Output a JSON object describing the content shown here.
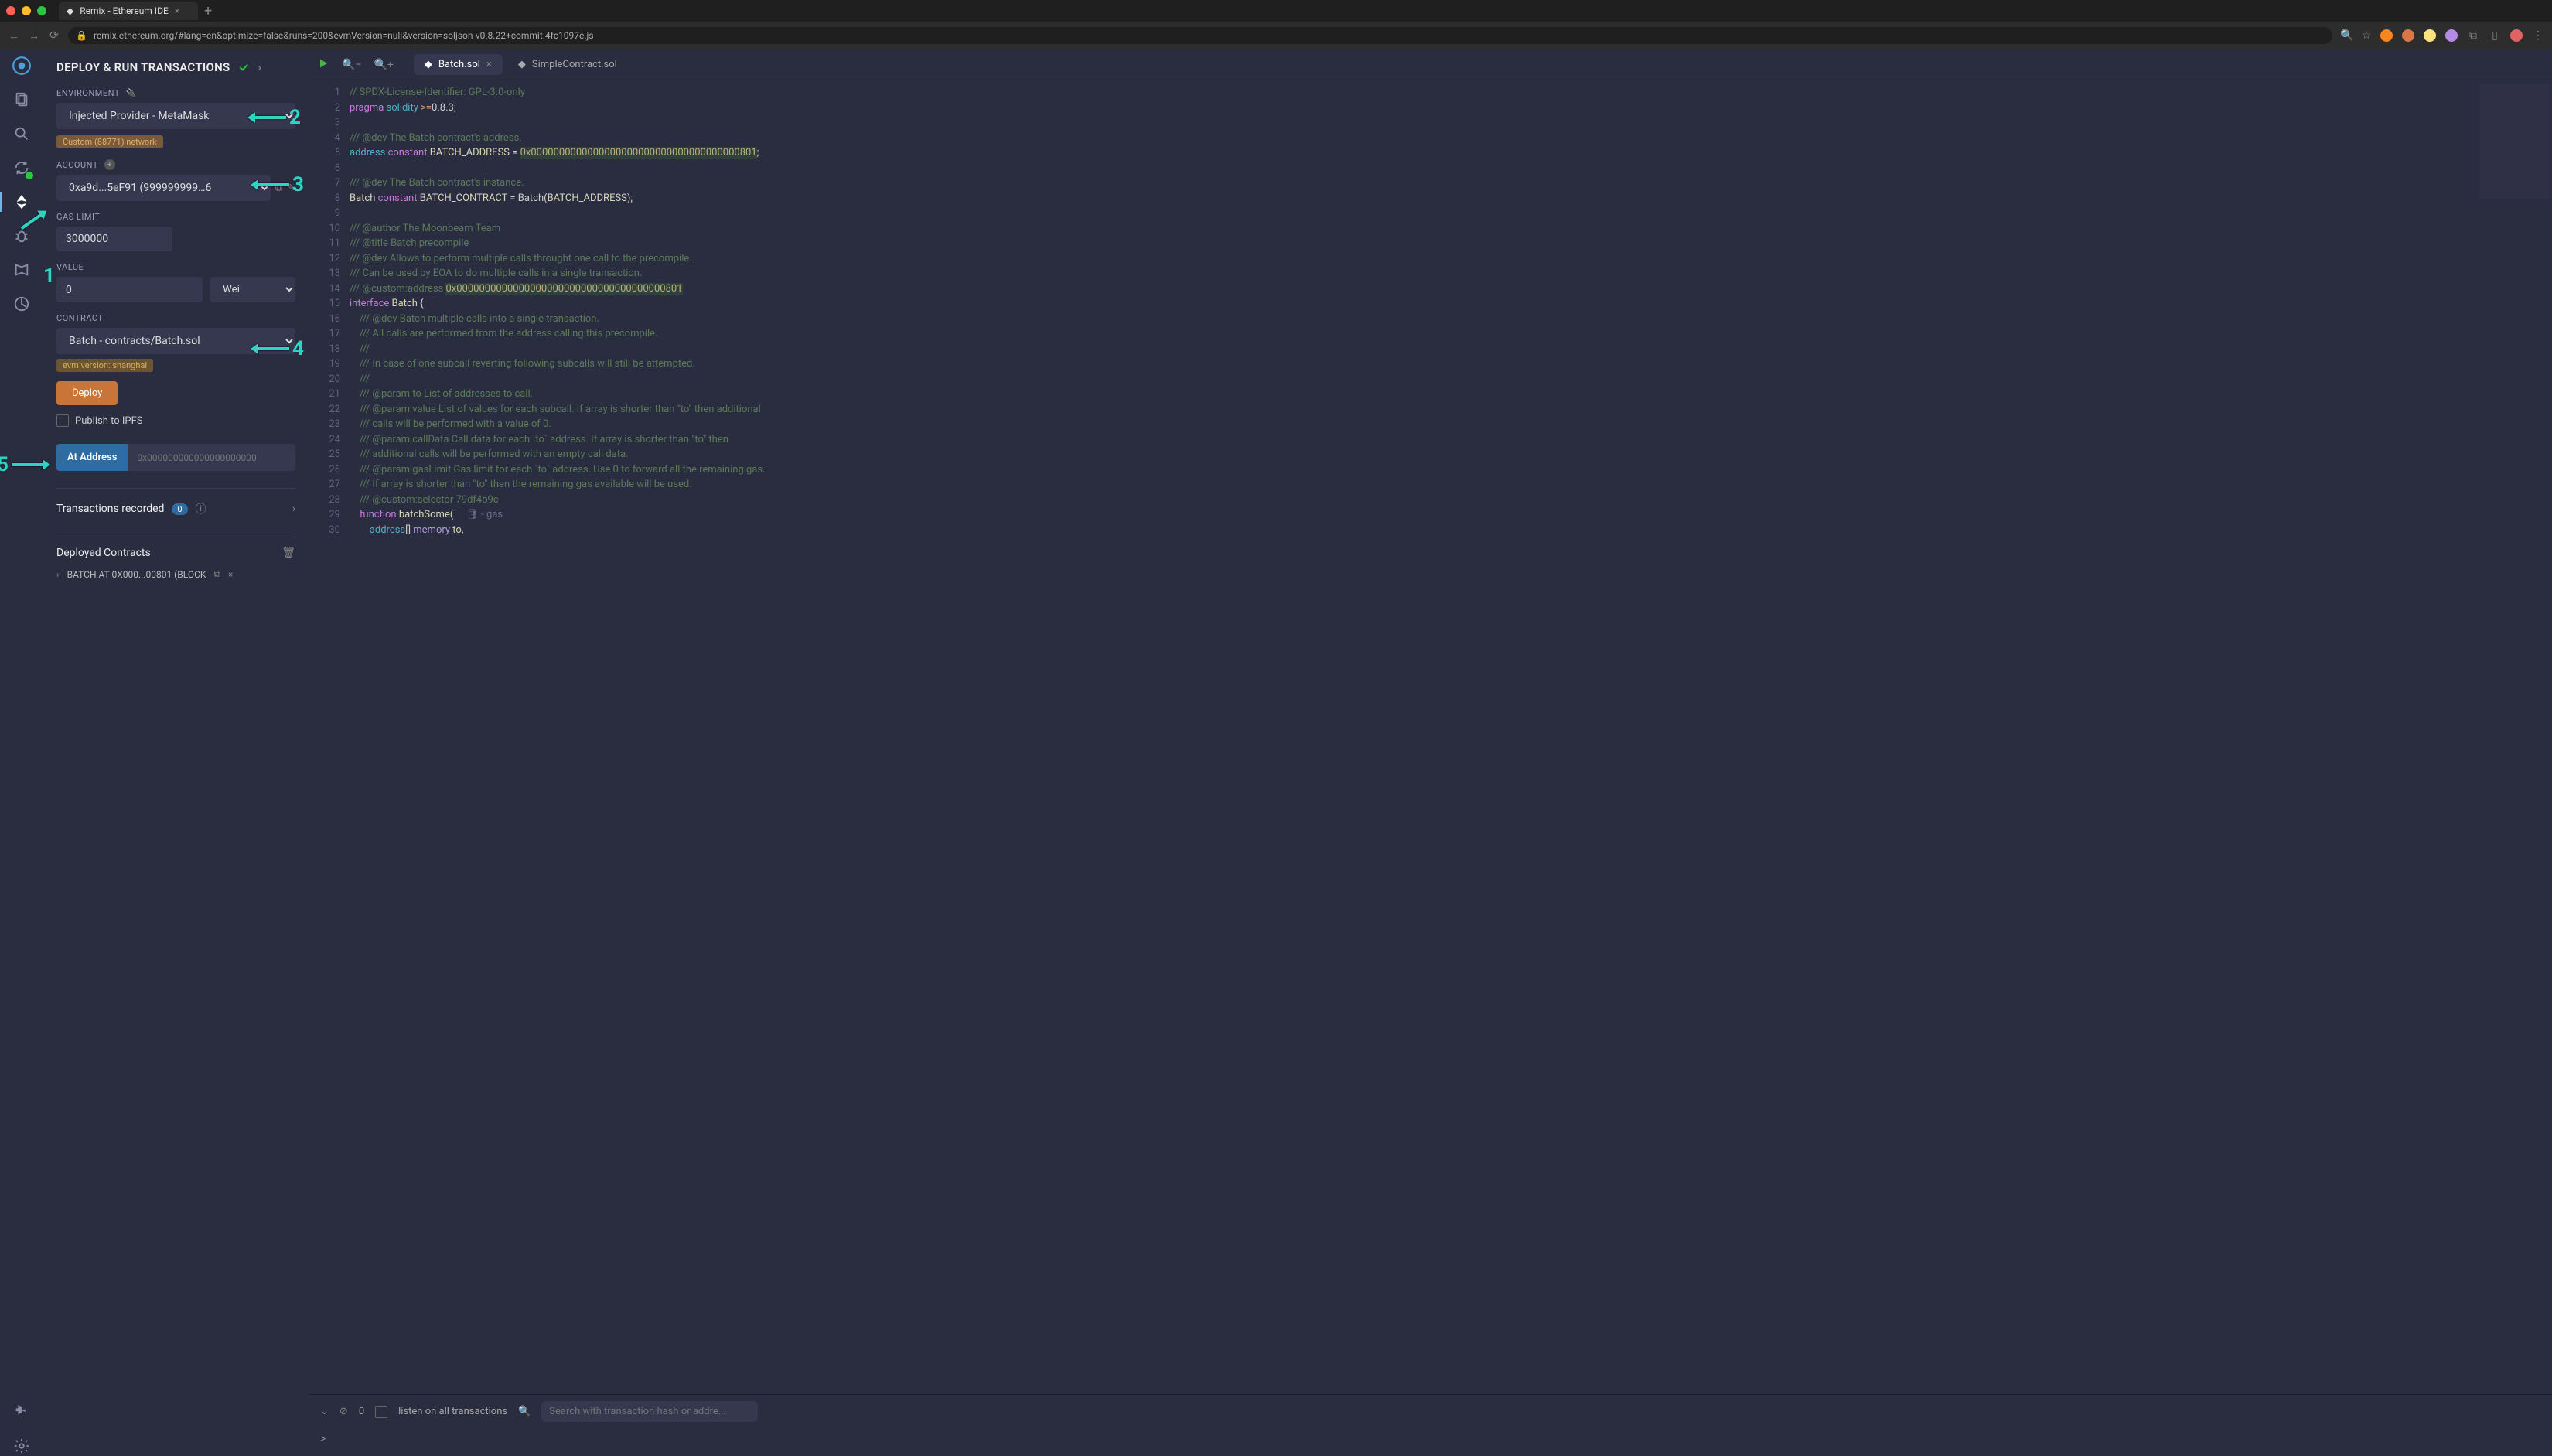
{
  "browser": {
    "tab_title": "Remix - Ethereum IDE",
    "url": "remix.ethereum.org/#lang=en&optimize=false&runs=200&evmVersion=null&version=soljson-v0.8.22+commit.4fc1097e.js"
  },
  "vertical_nav": {
    "items": [
      "logo",
      "files",
      "search",
      "compile",
      "deploy",
      "debug",
      "learn",
      "stats"
    ],
    "bottom": [
      "plugin",
      "settings"
    ]
  },
  "panel": {
    "title": "DEPLOY & RUN TRANSACTIONS",
    "env_label": "ENVIRONMENT",
    "env_value": "Injected Provider - MetaMask",
    "net_badge": "Custom (88771) network",
    "account_label": "ACCOUNT",
    "account_value": "0xa9d...5eF91 (999999999…6",
    "gas_label": "GAS LIMIT",
    "gas_value": "3000000",
    "value_label": "VALUE",
    "value_value": "0",
    "value_unit": "Wei",
    "contract_label": "CONTRACT",
    "contract_value": "Batch - contracts/Batch.sol",
    "evm_badge": "evm version: shanghai",
    "deploy_btn": "Deploy",
    "publish_ipfs": "Publish to IPFS",
    "at_address_btn": "At Address",
    "at_address_placeholder": "0x000000000000000000000",
    "trans_recorded": "Transactions recorded",
    "trans_count": "0",
    "deployed_label": "Deployed Contracts",
    "deployed_item": "BATCH AT 0X000...00801 (BLOCK"
  },
  "editor": {
    "tabs": [
      {
        "label": "Batch.sol",
        "active": true
      },
      {
        "label": "SimpleContract.sol",
        "active": false
      }
    ],
    "hint": "🛢 - gas",
    "code_lines": [
      {
        "n": 1,
        "html": "<span class='c-comm'>// SPDX-License-Identifier: GPL-3.0-only</span>"
      },
      {
        "n": 2,
        "html": "<span class='c-key'>pragma</span> <span class='c-type'>solidity</span> <span class='c-op'>&gt;=</span>0.8.3;"
      },
      {
        "n": 3,
        "html": ""
      },
      {
        "n": 4,
        "html": "<span class='c-comm'>/// @dev The Batch contract's address.</span>"
      },
      {
        "n": 5,
        "html": "<span class='c-type'>address</span> <span class='c-key'>constant</span> <span class='c-id'>BATCH_ADDRESS</span> = <span class='c-addr'>0x0000000000000000000000000000000000000801</span>;"
      },
      {
        "n": 6,
        "html": ""
      },
      {
        "n": 7,
        "html": "<span class='c-comm'>/// @dev The Batch contract's instance.</span>"
      },
      {
        "n": 8,
        "html": "<span class='c-id'>Batch</span> <span class='c-key'>constant</span> <span class='c-id'>BATCH_CONTRACT</span> = Batch(<span class='c-id'>BATCH_ADDRESS</span>);"
      },
      {
        "n": 9,
        "html": ""
      },
      {
        "n": 10,
        "html": "<span class='c-comm'>/// @author The Moonbeam Team</span>"
      },
      {
        "n": 11,
        "html": "<span class='c-comm'>/// @title Batch precompile</span>"
      },
      {
        "n": 12,
        "html": "<span class='c-comm'>/// @dev Allows to perform multiple calls throught one call to the precompile.</span>"
      },
      {
        "n": 13,
        "html": "<span class='c-comm'>/// Can be used by EOA to do multiple calls in a single transaction.</span>"
      },
      {
        "n": 14,
        "html": "<span class='c-comm'>/// @custom:address <span class='c-addr'>0x0000000000000000000000000000000000000801</span></span>"
      },
      {
        "n": 15,
        "html": "<span class='c-key'>interface</span> <span class='c-id'>Batch</span> {"
      },
      {
        "n": 16,
        "html": "    <span class='c-comm'>/// @dev Batch multiple calls into a single transaction.</span>"
      },
      {
        "n": 17,
        "html": "    <span class='c-comm'>/// All calls are performed from the address calling this precompile.</span>"
      },
      {
        "n": 18,
        "html": "    <span class='c-comm'>///</span>"
      },
      {
        "n": 19,
        "html": "    <span class='c-comm'>/// In case of one subcall reverting following subcalls will still be attempted.</span>"
      },
      {
        "n": 20,
        "html": "    <span class='c-comm'>///</span>"
      },
      {
        "n": 21,
        "html": "    <span class='c-comm'>/// @param to List of addresses to call.</span>"
      },
      {
        "n": 22,
        "html": "    <span class='c-comm'>/// @param value List of values for each subcall. If array is shorter than \"to\" then additional</span>"
      },
      {
        "n": 23,
        "html": "    <span class='c-comm'>/// calls will be performed with a value of 0.</span>"
      },
      {
        "n": 24,
        "html": "    <span class='c-comm'>/// @param callData Call data for each `to` address. If array is shorter than \"to\" then</span>"
      },
      {
        "n": 25,
        "html": "    <span class='c-comm'>/// additional calls will be performed with an empty call data.</span>"
      },
      {
        "n": 26,
        "html": "    <span class='c-comm'>/// @param gasLimit Gas limit for each `to` address. Use 0 to forward all the remaining gas.</span>"
      },
      {
        "n": 27,
        "html": "    <span class='c-comm'>/// If array is shorter than \"to\" then the remaining gas available will be used.</span>"
      },
      {
        "n": 28,
        "html": "    <span class='c-comm'>/// @custom:selector 79df4b9c</span>"
      },
      {
        "n": 29,
        "html": "    <span class='c-key'>function</span> <span class='c-id'>batchSome</span>("
      },
      {
        "n": 30,
        "html": "        <span class='c-type'>address</span>[] <span class='c-store'>memory</span> <span class='c-id'>to</span>,"
      }
    ]
  },
  "console": {
    "count": "0",
    "listen": "listen on all transactions",
    "search_placeholder": "Search with transaction hash or addre...",
    "prompt": ">"
  },
  "annotations": [
    "1",
    "2",
    "3",
    "4",
    "5"
  ]
}
